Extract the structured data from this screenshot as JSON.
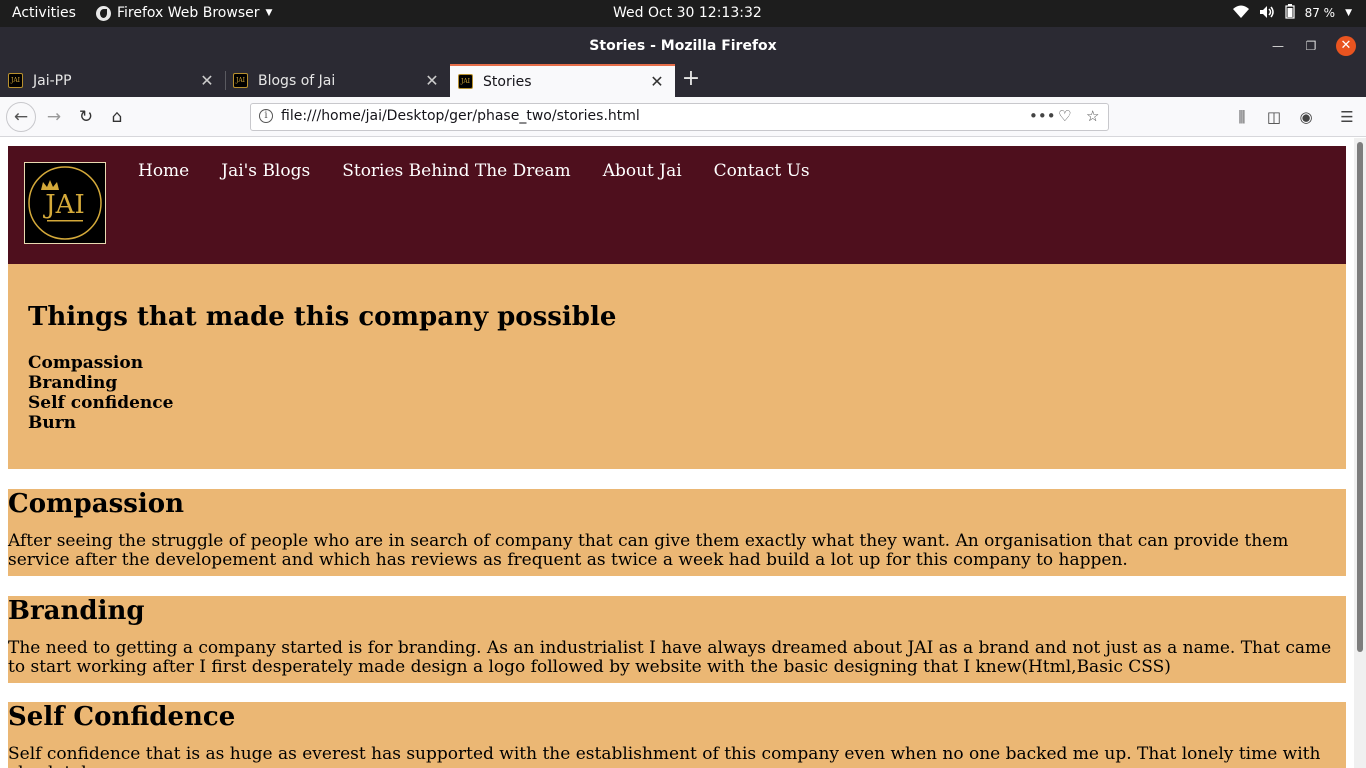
{
  "system": {
    "activities": "Activities",
    "app_menu": "Firefox Web Browser",
    "clock": "Wed Oct 30  12:13:32",
    "battery": "87 %"
  },
  "window": {
    "title": "Stories - Mozilla Firefox"
  },
  "tabs": [
    {
      "label": "Jai-PP",
      "active": false
    },
    {
      "label": "Blogs of Jai",
      "active": false
    },
    {
      "label": "Stories",
      "active": true
    }
  ],
  "urlbar": {
    "url": "file:///home/jai/Desktop/ger/phase_two/stories.html"
  },
  "site": {
    "logo_text": "JAI",
    "nav": [
      "Home",
      "Jai's Blogs",
      "Stories Behind The Dream",
      "About Jai",
      "Contact Us"
    ],
    "intro": {
      "heading": "Things that made this company possible",
      "items": [
        "Compassion",
        "Branding",
        "Self confidence",
        "Burn"
      ]
    },
    "stories": [
      {
        "heading": "Compassion",
        "text": "After seeing the struggle of people who are in search of company that can give them exactly what they want. An organisation that can provide them service after the developement and which has reviews as frequent as twice a week had build a lot up for this company to happen."
      },
      {
        "heading": "Branding",
        "text": "The need to getting a company started is for branding. As an industrialist I have always dreamed about JAI as a brand and not just as a name. That came to start working after I first desperately made design a logo followed by website with the basic designing that I knew(Html,Basic CSS)"
      },
      {
        "heading": "Self Confidence",
        "text": "Self confidence that is as huge as everest has supported with the establishment of this company even when no one backed me up. That lonely time with absolutely no"
      }
    ]
  },
  "colors": {
    "header_bg": "#4e0f1d",
    "section_bg": "#ebb774",
    "logo_gold": "#d4a93a"
  }
}
